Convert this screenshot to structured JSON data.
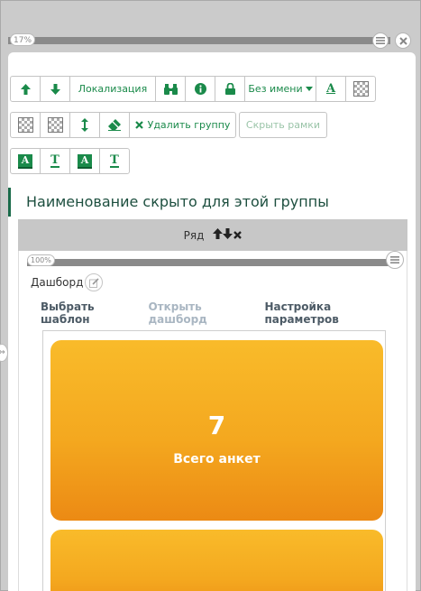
{
  "top_slider": {
    "zoom": "17%",
    "value_fraction": 0.17
  },
  "toolbar": {
    "row1": {
      "up_icon": "arrow-up-icon",
      "down_icon": "arrow-down-icon",
      "localization_label": "Локализация",
      "binoculars_icon": "binoculars-icon",
      "info_icon": "info-icon",
      "lock_icon": "lock-icon",
      "name_dropdown_label": "Без имени",
      "font_color_icon": "font-color-icon",
      "background_icon": "checker-icon"
    },
    "row2": {
      "checker1_icon": "checker-icon",
      "checker2_icon": "checker-icon",
      "vertical_resize_icon": "vertical-resize-icon",
      "eraser_icon": "eraser-icon",
      "delete_group_label": "Удалить группу",
      "hide_borders_label": "Скрыть рамки"
    },
    "row3": {
      "font_a_label": "A",
      "font_t_label": "T"
    }
  },
  "group": {
    "title": "Наименование скрыто для этой группы"
  },
  "row": {
    "label": "Ряд",
    "zoom": "100%",
    "value_fraction": 1.0
  },
  "dashboard": {
    "label": "Дашборд",
    "tabs": [
      {
        "label": "Выбрать шаблон",
        "enabled": true
      },
      {
        "label": "Открыть дашборд",
        "enabled": false
      },
      {
        "label": "Настройка параметров",
        "enabled": true
      }
    ],
    "tiles": [
      {
        "value": "7",
        "label": "Всего анкет"
      },
      {
        "value": "",
        "label": ""
      }
    ]
  },
  "colors": {
    "accent_green": "#1a8a4a",
    "tile_orange_top": "#f9bb2a",
    "tile_orange_bottom": "#ec8a14"
  }
}
